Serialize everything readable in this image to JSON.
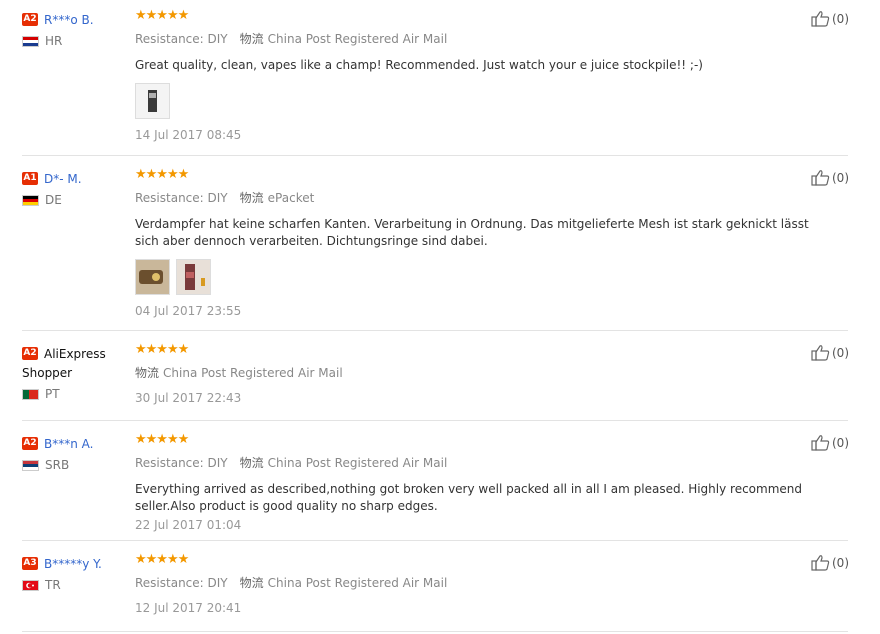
{
  "colors": {
    "star": "#f39800",
    "badge": "#e62e04",
    "user_link": "#3366cc",
    "divider": "#e3e3e3"
  },
  "reviews": [
    {
      "badge": "A2",
      "user": "R***o B.",
      "country": "HR",
      "flag": "flag-hr",
      "stars": "★★★★★",
      "resistance": "Resistance: DIY",
      "ship_label": "物流",
      "shipping": "China Post Registered Air Mail",
      "text": "Great quality, clean, vapes like a champ! Recommended. Just watch your e juice stockpile!! ;-)",
      "photos": 1,
      "date": "14 Jul 2017 08:45",
      "likes": "(0)"
    },
    {
      "badge": "A1",
      "user": "D*- M.",
      "country": "DE",
      "flag": "flag-de",
      "stars": "★★★★★",
      "resistance": "Resistance: DIY",
      "ship_label": "物流",
      "shipping": "ePacket",
      "text": "Verdampfer hat keine scharfen Kanten. Verarbeitung in Ordnung. Das mitgelieferte Mesh ist stark geknickt lässt sich aber dennoch verarbeiten. Dichtungsringe sind dabei.",
      "photos": 2,
      "date": "04 Jul 2017 23:55",
      "likes": "(0)"
    },
    {
      "badge": "A2",
      "user": "AliExpress Shopper",
      "country": "PT",
      "flag": "flag-pt",
      "stars": "★★★★★",
      "resistance": "",
      "ship_label": "物流",
      "shipping": "China Post Registered Air Mail",
      "text": "",
      "photos": 0,
      "date": "30 Jul 2017 22:43",
      "likes": "(0)"
    },
    {
      "badge": "A2",
      "user": "B***n A.",
      "country": "SRB",
      "flag": "flag-rs",
      "stars": "★★★★★",
      "resistance": "Resistance: DIY",
      "ship_label": "物流",
      "shipping": "China Post Registered Air Mail",
      "text": "Everything arrived as described,nothing got broken very well packed all in all I am pleased. Highly recommend seller.Also product is good quality no sharp edges.",
      "photos": 0,
      "date": "22 Jul 2017 01:04",
      "likes": "(0)"
    },
    {
      "badge": "A3",
      "user": "B*****y Y.",
      "country": "TR",
      "flag": "flag-tr",
      "stars": "★★★★★",
      "resistance": "Resistance: DIY",
      "ship_label": "物流",
      "shipping": "China Post Registered Air Mail",
      "text": "",
      "photos": 0,
      "date": "12 Jul 2017 20:41",
      "likes": "(0)"
    }
  ]
}
